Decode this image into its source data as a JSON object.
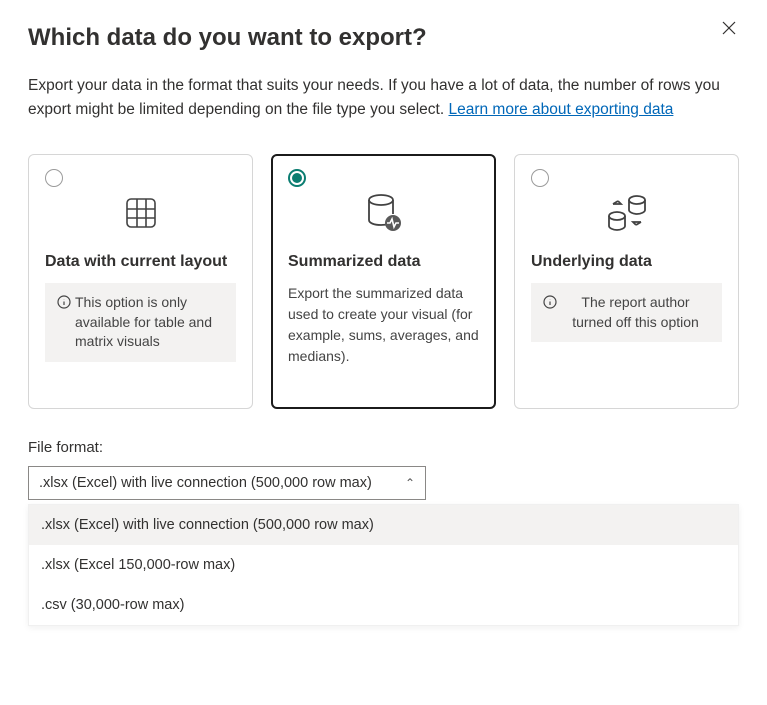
{
  "dialog": {
    "title": "Which data do you want to export?",
    "description": "Export your data in the format that suits your needs. If you have a lot of data, the number of rows you export might be limited depending on the file type you select.  ",
    "learn_more_label": "Learn more about exporting data"
  },
  "options": [
    {
      "title": "Data with current layout",
      "selected": false,
      "message": "This option is only available for table and matrix visuals",
      "has_info_icon": true,
      "icon": "table-icon"
    },
    {
      "title": "Summarized data",
      "selected": true,
      "description": "Export the summarized data used to create your visual (for example, sums, averages, and medians).",
      "icon": "database-pulse-icon"
    },
    {
      "title": "Underlying data",
      "selected": false,
      "message": "The report author turned off this option",
      "has_info_icon": true,
      "message_centered": true,
      "icon": "database-swap-icon"
    }
  ],
  "file_format": {
    "label": "File format:",
    "selected": ".xlsx (Excel) with live connection (500,000 row max)",
    "options": [
      ".xlsx (Excel) with live connection (500,000 row max)",
      ".xlsx (Excel 150,000-row max)",
      ".csv (30,000-row max)"
    ]
  }
}
